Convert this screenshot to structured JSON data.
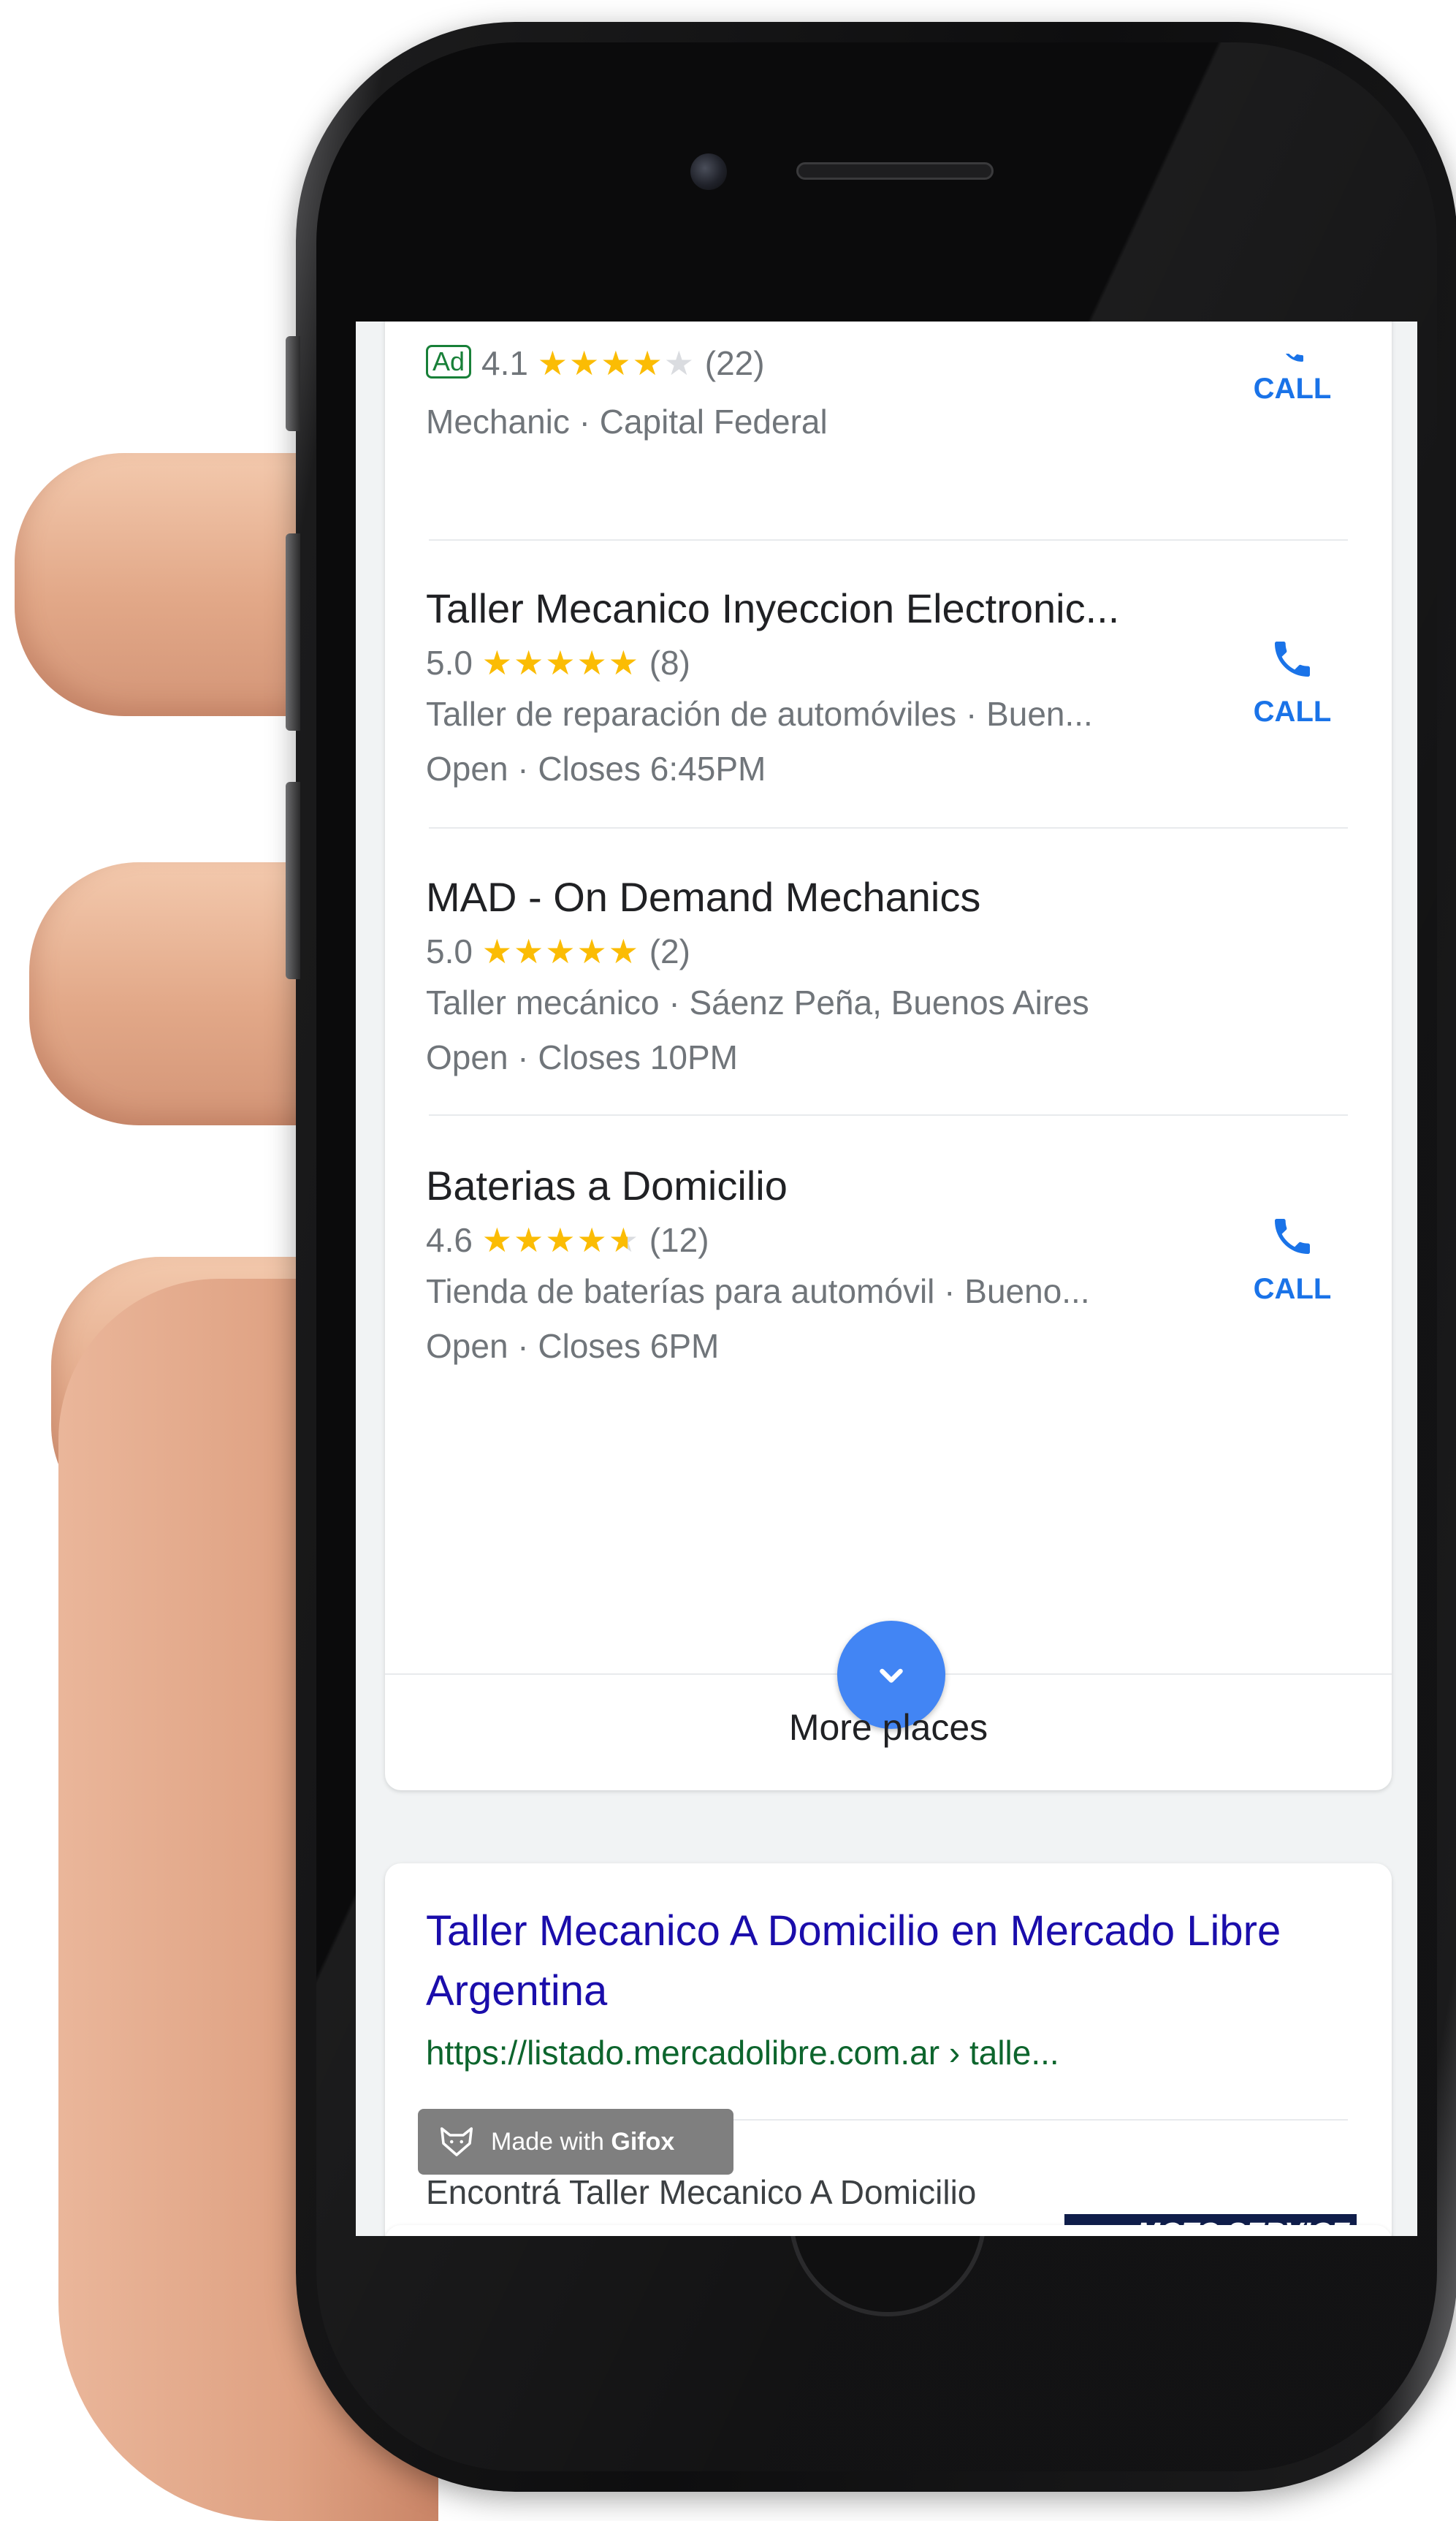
{
  "places": [
    {
      "ad": "Ad",
      "rating": "4.1",
      "stars": 4.1,
      "reviews": "(22)",
      "category_line": "Mechanic · Capital Federal",
      "has_call": true
    },
    {
      "name": "Taller Mecanico Inyeccion Electronic...",
      "rating": "5.0",
      "stars": 5,
      "reviews": "(8)",
      "category_line": "Taller de reparación de automóviles · Buen...",
      "hours": "Open · Closes 6:45PM",
      "has_call": true
    },
    {
      "name": "MAD - On Demand Mechanics",
      "rating": "5.0",
      "stars": 5,
      "reviews": "(2)",
      "category_line": "Taller mecánico · Sáenz Peña, Buenos Aires",
      "hours": "Open · Closes 10PM",
      "has_call": false
    },
    {
      "name": "Baterias a Domicilio",
      "rating": "4.6",
      "stars": 4.6,
      "reviews": "(12)",
      "category_line": "Tienda de baterías para automóvil · Bueno...",
      "hours": "Open · Closes 6PM",
      "has_call": true
    }
  ],
  "call_label": "CALL",
  "more_places_label": "More places",
  "result": {
    "title": "Taller Mecanico A Domicilio en Mercado Libre Argentina",
    "url": "https://listado.mercadolibre.com.ar › talle...",
    "snippet": "Encontrá Taller Mecanico A Domicilio en Mercado Libre Argentina. Descubrí la mejor forma de comprar online.",
    "thumbnail_text": "MOTO SERVICE"
  },
  "watermark": {
    "prefix": "Made with ",
    "brand": "Gifox"
  },
  "colors": {
    "link": "#1a0dab",
    "url_green": "#0d652d",
    "accent_blue": "#1a73e8",
    "star": "#fbbc04",
    "fab_blue": "#4285f4"
  },
  "icons": [
    "phone-icon",
    "chevron-down-icon",
    "fox-icon"
  ]
}
